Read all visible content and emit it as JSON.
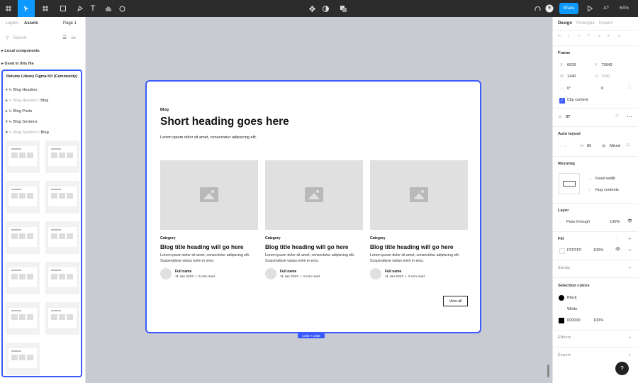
{
  "toolbar": {
    "share_label": "Share",
    "zoom": "64%",
    "icons": [
      "figma-menu-icon",
      "move-tool-icon",
      "frame-tool-icon",
      "shape-tool-icon",
      "pen-tool-icon",
      "text-tool-icon",
      "hand-tool-icon",
      "comment-tool-icon",
      "components-icon",
      "mask-icon",
      "boolean-icon",
      "headphones-icon",
      "avatar-icon",
      "present-icon",
      "text-style-icon"
    ],
    "aa_label": "A?"
  },
  "left_panel": {
    "tabs": [
      "Layers",
      "Assets"
    ],
    "active_tab": "Assets",
    "page": "Page 1",
    "search_placeholder": "Search",
    "sections": [
      "Local components",
      "Used in this file"
    ],
    "library": {
      "title": "Relume Library Figma Kit (Community)",
      "items": [
        {
          "label": "Blog Headers",
          "prefix": ""
        },
        {
          "label": "Blog",
          "prefix": "Blog Headers / "
        },
        {
          "label": "Blog Posts",
          "prefix": ""
        },
        {
          "label": "Blog Sections",
          "prefix": ""
        },
        {
          "label": "Blog",
          "prefix": "Blog Sections / "
        }
      ]
    }
  },
  "canvas": {
    "tag": "Blog",
    "heading": "Short heading goes here",
    "lede": "Lorem ipsum dolor sit amet, consectetur adipiscing elit.",
    "cards": [
      {
        "category": "Category",
        "title": "Blog title heading will go here",
        "excerpt": "Lorem ipsum dolor sit amet, consectetur adipiscing elit. Suspendisse varius enim in eros.",
        "author": "Full name",
        "date": "11 Jan 2022",
        "read": "5 min read"
      },
      {
        "category": "Category",
        "title": "Blog title heading will go here",
        "excerpt": "Lorem ipsum dolor sit amet, consectetur adipiscing elit. Suspendisse varius enim in eros.",
        "author": "Full name",
        "date": "11 Jan 2022",
        "read": "5 min read"
      },
      {
        "category": "Category",
        "title": "Blog title heading will go here",
        "excerpt": "Lorem ipsum dolor sit amet, consectetur adipiscing elit. Suspendisse varius enim in eros.",
        "author": "Full name",
        "date": "11 Jan 2022",
        "read": "5 min read"
      }
    ],
    "view_all": "View all",
    "dimension_badge": "1440 × 1082"
  },
  "right_panel": {
    "tabs": [
      "Design",
      "Prototype",
      "Inspect"
    ],
    "frame_label": "Frame",
    "x": "6639",
    "y": "73843",
    "w": "1440",
    "h": "1080",
    "rotation": "0°",
    "radius": "0",
    "clip_content": "Clip content",
    "instance_value": "37",
    "auto_layout": "Auto layout",
    "spacing": "80",
    "padding": "Mixed",
    "resizing": "Resizing",
    "fixed_width": "Fixed width",
    "hug_contents": "Hug contents",
    "layer": "Layer",
    "pass_through": "Pass through",
    "layer_opacity": "100%",
    "fill": "Fill",
    "fill_hex": "FFFFFF",
    "fill_opacity": "100%",
    "stroke": "Stroke",
    "selection_colors": "Selection colors",
    "colors": [
      {
        "name": "Black",
        "hex": "#000000"
      },
      {
        "name": "White",
        "hex": "#FFFFFF"
      },
      {
        "name": "000000",
        "hex": "#000000",
        "opacity": "100%"
      }
    ],
    "effects": "Effects",
    "export": "Export"
  },
  "help": "?",
  "accent": "#3b5bfd",
  "share_color": "#0d99ff"
}
